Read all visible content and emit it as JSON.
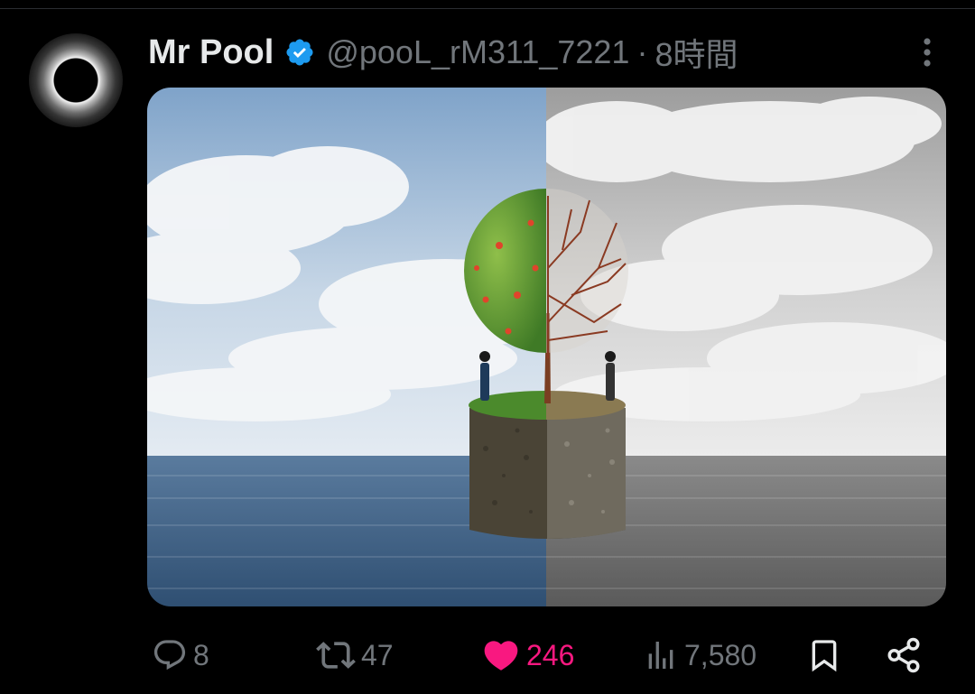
{
  "tweet": {
    "author": {
      "display_name": "Mr Pool",
      "handle": "@pooL_rM311_7221",
      "verified": true
    },
    "separator": "·",
    "timestamp": "8時間",
    "media": {
      "description_icon": "image",
      "left_tone": "color",
      "right_tone": "grayscale"
    },
    "actions": {
      "reply_count": "8",
      "repost_count": "47",
      "like_count": "246",
      "liked": true,
      "view_count": "7,580"
    }
  },
  "colors": {
    "background": "#000000",
    "text_primary": "#e7e9ea",
    "text_secondary": "#71767b",
    "verified_blue": "#1d9bf0",
    "like_pink": "#f91880"
  },
  "icons": {
    "verified": "verified-badge-icon",
    "more": "more-vertical-icon",
    "reply": "reply-icon",
    "repost": "repost-icon",
    "like": "heart-filled-icon",
    "views": "views-bar-chart-icon",
    "bookmark": "bookmark-icon",
    "share": "share-icon"
  }
}
